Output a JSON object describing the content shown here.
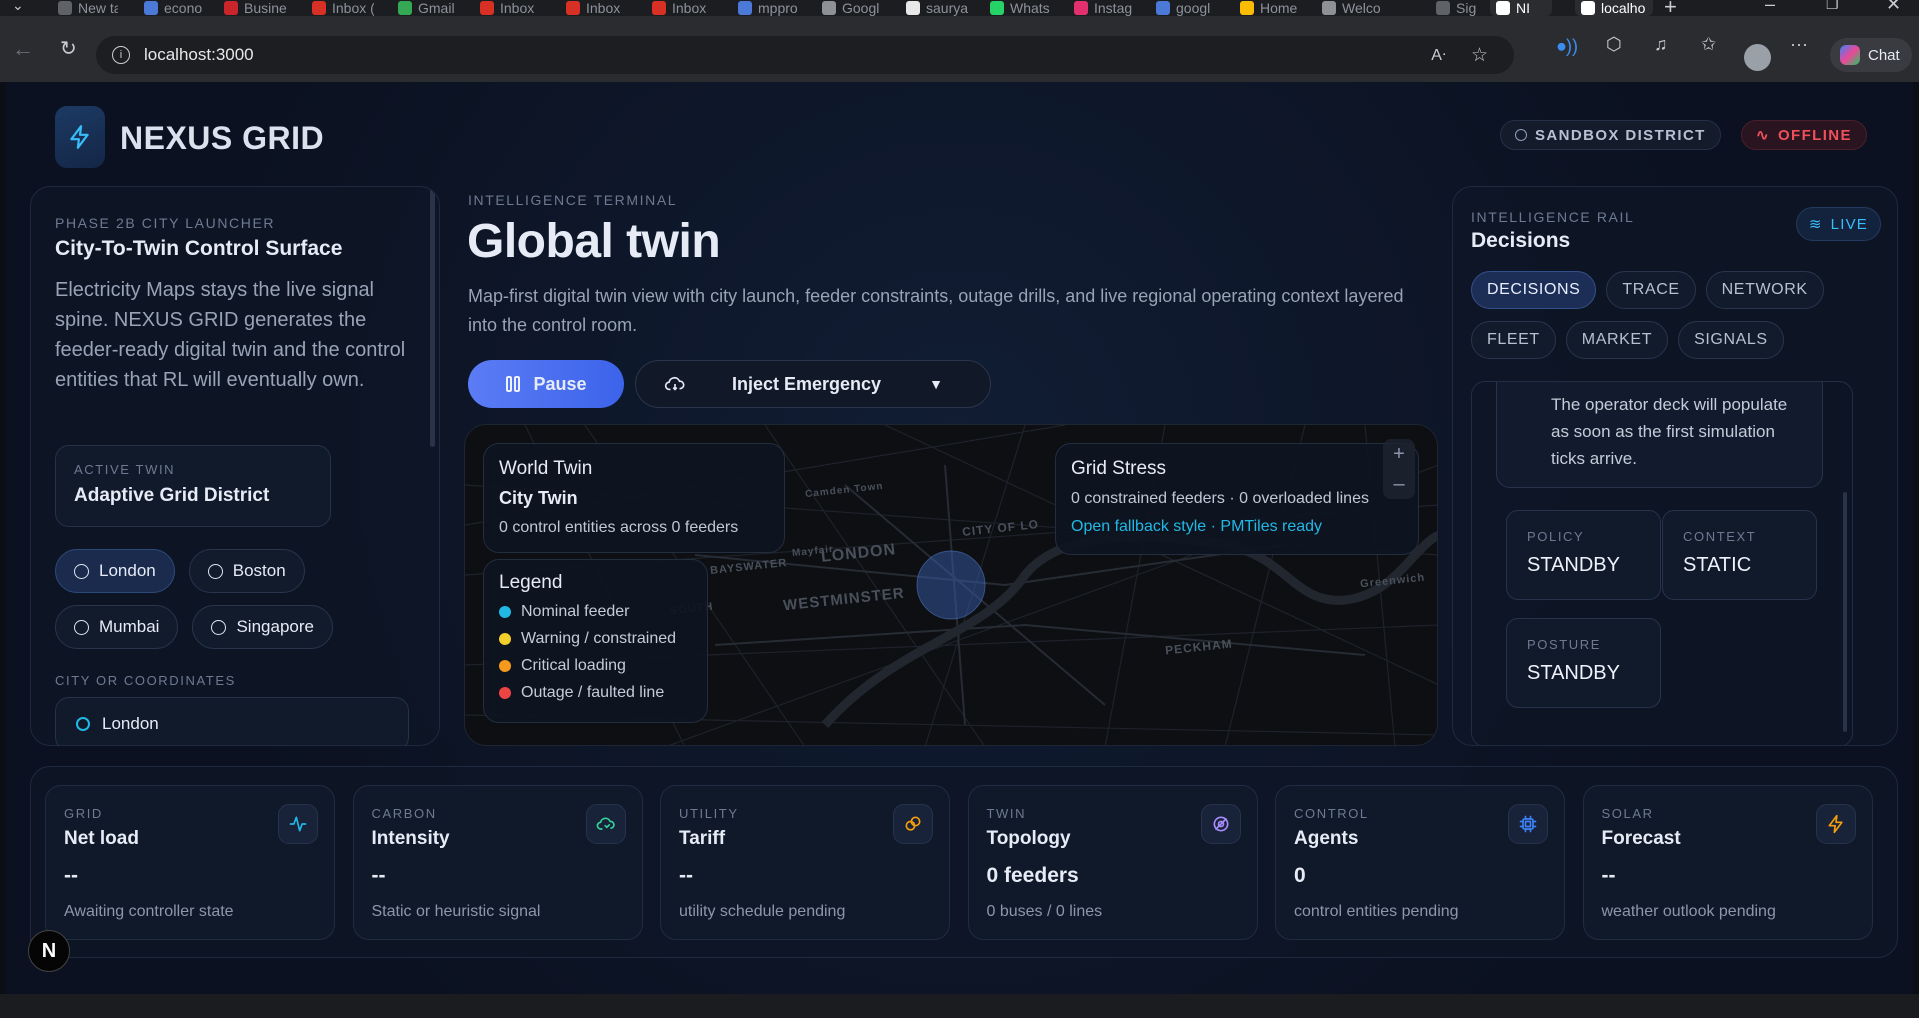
{
  "browser": {
    "tabs": [
      {
        "label": "New ta",
        "color": "#5f6368"
      },
      {
        "label": "econo",
        "color": "#4a79d8"
      },
      {
        "label": "Busine",
        "color": "#c8262b"
      },
      {
        "label": "Inbox (",
        "color": "#d93025"
      },
      {
        "label": "Gmail",
        "color": "#34a853"
      },
      {
        "label": "Inbox",
        "color": "#d93025"
      },
      {
        "label": "Inbox",
        "color": "#d93025"
      },
      {
        "label": "Inbox",
        "color": "#d93025"
      },
      {
        "label": "mppro",
        "color": "#4a79d8"
      },
      {
        "label": "Googl",
        "color": "#8e9196"
      },
      {
        "label": "saurya",
        "color": "#e8e8e8"
      },
      {
        "label": "Whats",
        "color": "#25d366"
      },
      {
        "label": "Instag",
        "color": "#e1306c"
      },
      {
        "label": "googl",
        "color": "#4a79d8"
      },
      {
        "label": "Home",
        "color": "#fbbc04"
      },
      {
        "label": "Welco",
        "color": "#8e9196"
      },
      {
        "label": "Sign ir",
        "color": "#5f6368"
      },
      {
        "label": "NI",
        "color": "#ffffff"
      },
      {
        "label": "localho",
        "color": "#ffffff"
      }
    ],
    "url": "localhost:3000",
    "copilot_label": "Chat"
  },
  "header": {
    "brand": "NEXUS GRID",
    "district_badge": "SANDBOX DISTRICT",
    "status_badge": "OFFLINE"
  },
  "launcher": {
    "eyebrow": "PHASE 2B CITY LAUNCHER",
    "title": "City-To-Twin Control Surface",
    "description": "Electricity Maps stays the live signal spine. NEXUS GRID generates the feeder-ready digital twin and the control entities that RL will eventually own.",
    "active_label": "ACTIVE TWIN",
    "active_value": "Adaptive Grid District",
    "cities": [
      "London",
      "Boston",
      "Mumbai",
      "Singapore"
    ],
    "coord_label": "CITY OR COORDINATES",
    "coord_value": "London"
  },
  "terminal": {
    "eyebrow": "INTELLIGENCE TERMINAL",
    "title": "Global twin",
    "description": "Map-first digital twin view with city launch, feeder constraints, outage drills, and live regional operating context layered into the control room.",
    "pause_label": "Pause",
    "emergency_label": "Inject Emergency"
  },
  "map": {
    "world_label": "World Twin",
    "city_twin": "City Twin",
    "entities": "0 control entities across 0 feeders",
    "legend_title": "Legend",
    "legend": [
      {
        "label": "Nominal feeder",
        "color": "#22b8e6"
      },
      {
        "label": "Warning / constrained",
        "color": "#f2cf2a"
      },
      {
        "label": "Critical loading",
        "color": "#f59a1c"
      },
      {
        "label": "Outage / faulted line",
        "color": "#ef4444"
      }
    ],
    "stress_title": "Grid Stress",
    "stress_text": "0 constrained feeders · 0 overloaded lines",
    "stress_link": "Open fallback style · PMTiles ready",
    "place_labels": [
      "LONDON",
      "WESTMINSTER",
      "CITY OF LO",
      "BAYSWATER",
      "Camden Town",
      "Greenwich",
      "PECKHAM",
      "SOUTH",
      "Mayfair"
    ]
  },
  "rail": {
    "eyebrow": "INTELLIGENCE RAIL",
    "title": "Decisions",
    "live_label": "LIVE",
    "tabs": [
      "DECISIONS",
      "TRACE",
      "NETWORK",
      "FLEET",
      "MARKET",
      "SIGNALS"
    ],
    "message": "The operator deck will populate as soon as the first simulation ticks arrive.",
    "tiles": [
      {
        "label": "POLICY",
        "value": "STANDBY"
      },
      {
        "label": "CONTEXT",
        "value": "STATIC"
      },
      {
        "label": "POSTURE",
        "value": "STANDBY"
      }
    ]
  },
  "stats": [
    {
      "label": "GRID",
      "title": "Net load",
      "value": "--",
      "sub": "Awaiting controller state",
      "icon": "activity-icon",
      "color": "#22b8e6"
    },
    {
      "label": "CARBON",
      "title": "Intensity",
      "value": "--",
      "sub": "Static or heuristic signal",
      "icon": "leaf-cloud-icon",
      "color": "#34d399"
    },
    {
      "label": "UTILITY",
      "title": "Tariff",
      "value": "--",
      "sub": "utility schedule pending",
      "icon": "coins-icon",
      "color": "#f59e0b"
    },
    {
      "label": "TWIN",
      "title": "Topology",
      "value": "0 feeders",
      "sub": "0 buses / 0 lines",
      "icon": "orbit-icon",
      "color": "#a78bfa"
    },
    {
      "label": "CONTROL",
      "title": "Agents",
      "value": "0",
      "sub": "control entities pending",
      "icon": "cpu-icon",
      "color": "#3b82f6"
    },
    {
      "label": "SOLAR",
      "title": "Forecast",
      "value": "--",
      "sub": "weather outlook pending",
      "icon": "bolt-icon",
      "color": "#f59e0b"
    }
  ],
  "dev_badge": "N"
}
